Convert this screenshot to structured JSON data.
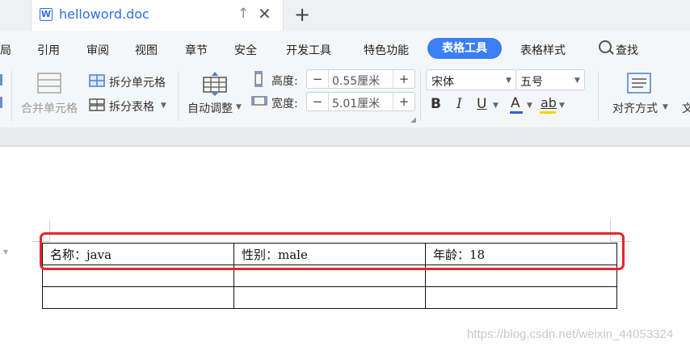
{
  "tab": {
    "doc_icon_letter": "W",
    "title": "helloword.doc",
    "up_glyph": "↑",
    "close_glyph": "✕",
    "new_glyph": "+"
  },
  "menu": {
    "items": [
      "局",
      "引用",
      "审阅",
      "视图",
      "章节",
      "安全",
      "开发工具",
      "特色功能",
      "表格工具",
      "表格样式",
      "查找"
    ],
    "active": "表格工具"
  },
  "ribbon": {
    "merge_cells": "合并单元格",
    "split_cells": "拆分单元格",
    "split_table": "拆分表格",
    "auto_adjust": "自动调整",
    "height_label": "高度:",
    "height_value": "0.55厘米",
    "width_label": "宽度:",
    "width_value": "5.01厘米",
    "font_name": "宋体",
    "font_size": "五号",
    "bold": "B",
    "italic": "I",
    "underline": "U",
    "font_color": "A",
    "highlight": "ab",
    "align": "对齐方式",
    "text_dir_partial": "文"
  },
  "table": {
    "rows": [
      [
        "名称：java",
        "性别：male",
        "年龄：18"
      ],
      [
        "",
        "",
        ""
      ],
      [
        "",
        "",
        ""
      ]
    ]
  },
  "watermark": "https://blog.csdn.net/weixin_44053324",
  "colors": {
    "accent": "#3a7ff5",
    "highlight_border": "#e8262a",
    "font_color_bar": "#2f5fe0",
    "highlight_bar": "#f5d400"
  }
}
